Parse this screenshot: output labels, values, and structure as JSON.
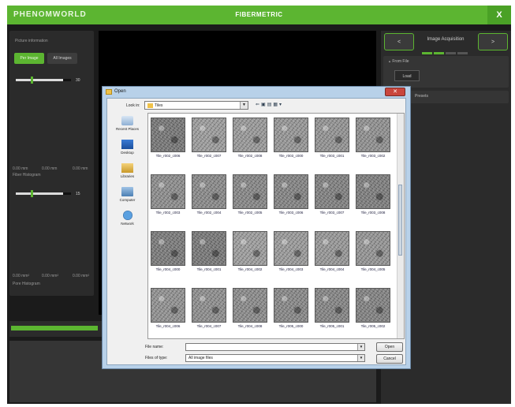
{
  "app": {
    "brand": "PHENOMWORLD",
    "title": "FIBERMETRIC",
    "close_label": "X",
    "accent": "#5cb531"
  },
  "left_panel": {
    "section_title": "Picture information",
    "tabs": [
      {
        "label": "Per Image",
        "active": true
      },
      {
        "label": "All Images",
        "active": false
      }
    ],
    "fiber_slider": {
      "value": "30"
    },
    "fiber_axis": [
      "0.00 mm",
      "0.00 mm",
      "0.00 mm"
    ],
    "fiber_histogram_title": "Fiber Histogram",
    "pore_slider": {
      "value": "15"
    },
    "pore_axis": [
      "0.00 mm²",
      "0.00 mm²",
      "0.00 mm²"
    ],
    "pore_histogram_title": "Pore Histogram"
  },
  "right_panel": {
    "prev_label": "<",
    "next_label": ">",
    "acquisition_label": "Image Acquisition",
    "acquisition_steps": [
      true,
      true,
      false,
      false
    ],
    "from_file_label": "From File",
    "load_label": "Load",
    "presets_label": "Presets"
  },
  "dialog": {
    "title": "Open",
    "close_label": "✕",
    "look_in_label": "Look in:",
    "look_in_value": "Tiles",
    "places": [
      "Recent Places",
      "Desktop",
      "Libraries",
      "Computer",
      "Network"
    ],
    "files": [
      "Tile_r002_c006",
      "Tile_r002_c007",
      "Tile_r002_c008",
      "Tile_r003_c000",
      "Tile_r003_c001",
      "Tile_r003_c002",
      "Tile_r002_c003",
      "Tile_r002_c004",
      "Tile_r002_c005",
      "Tile_r003_c006",
      "Tile_r003_c007",
      "Tile_r003_c008",
      "Tile_r004_c000",
      "Tile_r004_c001",
      "Tile_r004_c002",
      "Tile_r004_c003",
      "Tile_r004_c004",
      "Tile_r004_c005",
      "Tile_r004_c006",
      "Tile_r004_c007",
      "Tile_r004_c008",
      "Tile_r005_c000",
      "Tile_r005_c001",
      "Tile_r005_c002"
    ],
    "file_name_label": "File name:",
    "file_name_value": "",
    "file_type_label": "Files of type:",
    "file_type_value": "All image files",
    "open_label": "Open",
    "cancel_label": "Cancel"
  }
}
